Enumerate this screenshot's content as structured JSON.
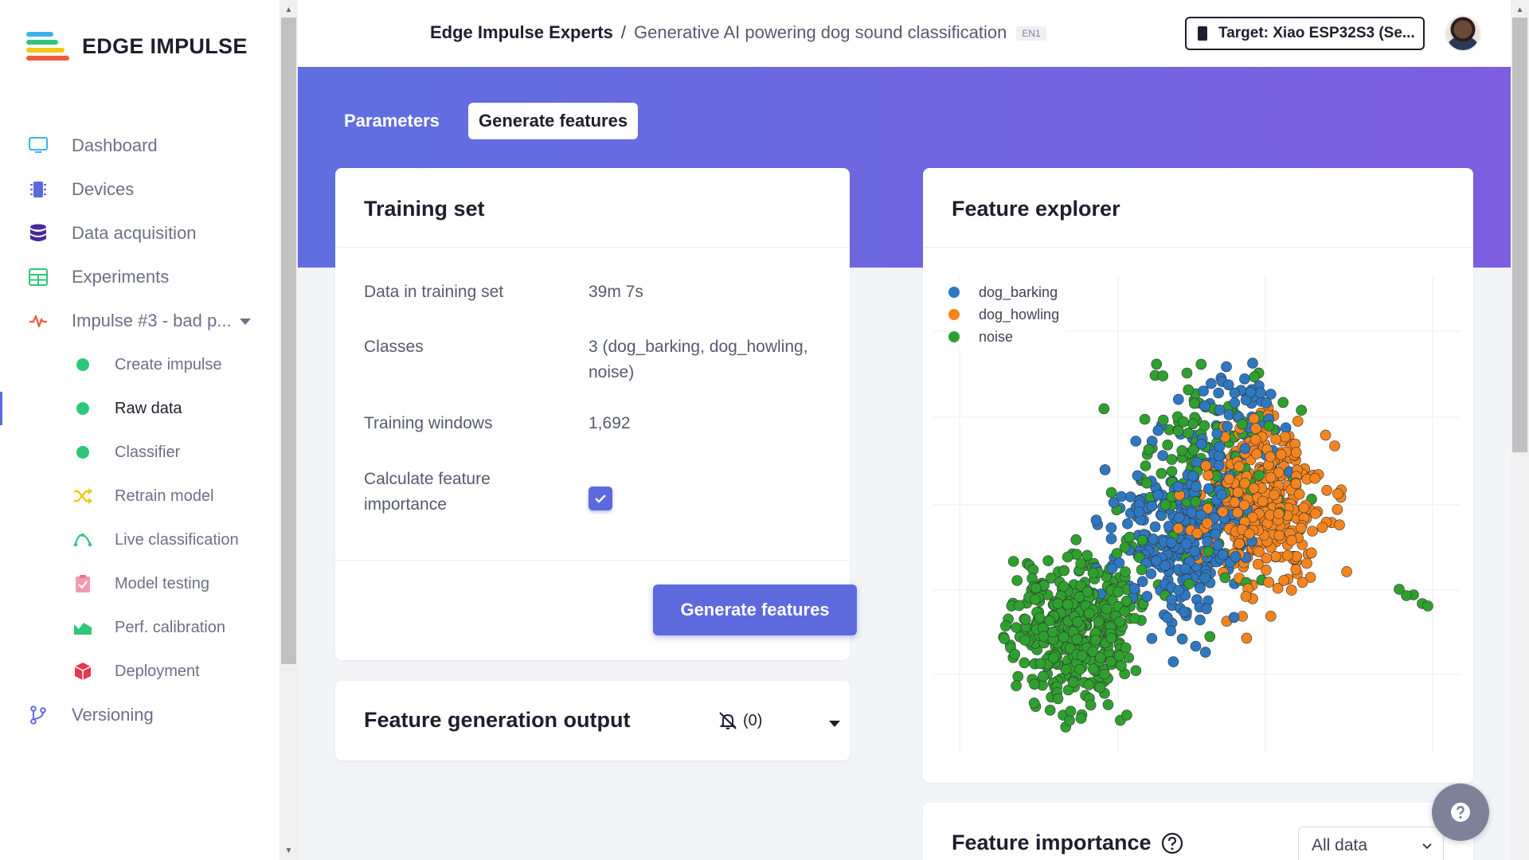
{
  "app": {
    "logo_text": "EDGE IMPULSE"
  },
  "sidebar": {
    "items": [
      {
        "label": "Dashboard",
        "icon": "monitor-icon"
      },
      {
        "label": "Devices",
        "icon": "chip-icon"
      },
      {
        "label": "Data acquisition",
        "icon": "database-icon"
      },
      {
        "label": "Experiments",
        "icon": "table-icon"
      },
      {
        "label": "Impulse #3 - bad p...",
        "icon": "pulse-icon"
      },
      {
        "label": "Create impulse",
        "icon": "dot-icon"
      },
      {
        "label": "Raw data",
        "icon": "dot-icon"
      },
      {
        "label": "Classifier",
        "icon": "dot-icon"
      },
      {
        "label": "Retrain model",
        "icon": "shuffle-icon"
      },
      {
        "label": "Live classification",
        "icon": "wave-icon"
      },
      {
        "label": "Model testing",
        "icon": "clipboard-check-icon"
      },
      {
        "label": "Perf. calibration",
        "icon": "area-chart-icon"
      },
      {
        "label": "Deployment",
        "icon": "box-icon"
      },
      {
        "label": "Versioning",
        "icon": "branch-icon"
      }
    ]
  },
  "header": {
    "project": "Edge Impulse Experts",
    "separator": "/",
    "page": "Generative AI powering dog sound classification",
    "tag": "EN1",
    "target_label": "Target: Xiao ESP32S3 (Se..."
  },
  "tabs": {
    "parameters": "Parameters",
    "generate": "Generate features"
  },
  "training_set": {
    "title": "Training set",
    "rows": [
      {
        "label": "Data in training set",
        "value": "39m 7s"
      },
      {
        "label": "Classes",
        "value": "3 (dog_barking, dog_howling, noise)"
      },
      {
        "label": "Training windows",
        "value": "1,692"
      },
      {
        "label": "Calculate feature importance",
        "value": ""
      }
    ],
    "button": "Generate features"
  },
  "output": {
    "title": "Feature generation output",
    "count": "(0)"
  },
  "explorer": {
    "title": "Feature explorer",
    "legend": [
      {
        "name": "dog_barking",
        "color": "#2e78c2"
      },
      {
        "name": "dog_howling",
        "color": "#f5841f"
      },
      {
        "name": "noise",
        "color": "#2ea02e"
      }
    ]
  },
  "importance": {
    "title": "Feature importance",
    "select_value": "All data"
  },
  "colors": {
    "accent": "#5c6ade",
    "banner_start": "#5f6fe0",
    "banner_end": "#7d5ee0"
  }
}
